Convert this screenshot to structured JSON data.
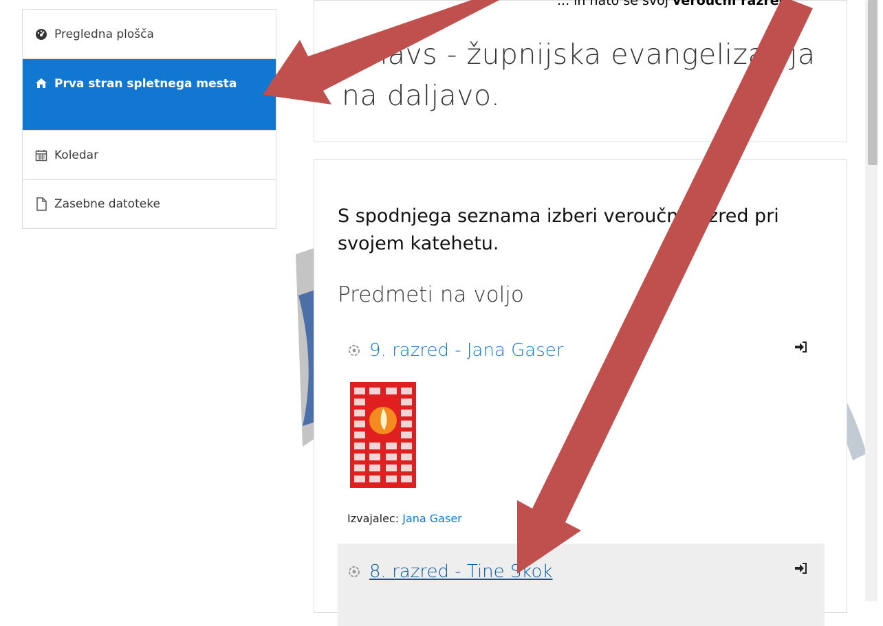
{
  "nav": {
    "items": [
      {
        "label": "Pregledna plošča",
        "icon": "dashboard-icon"
      },
      {
        "label": "Prva stran spletnega mesta",
        "icon": "home-icon",
        "active": true
      },
      {
        "label": "Koledar",
        "icon": "calendar-icon"
      },
      {
        "label": "Zasebne datoteke",
        "icon": "file-icon"
      }
    ]
  },
  "site": {
    "title": "Emavs - župnijska evangelizacija na daljavo."
  },
  "main": {
    "intro": "S spodnjega seznama izberi veroučni razred pri svojem katehetu.",
    "section_heading": "Predmeti na voljo",
    "courses": [
      {
        "name": "9. razred - Jana Gaser",
        "teacher_label": "Izvajalec:",
        "teacher": "Jana Gaser"
      },
      {
        "name": "8. razred - Tine Skok"
      }
    ]
  },
  "annotation": {
    "prefix": "... in nato še svoj",
    "bold": "veroučni razred."
  },
  "colors": {
    "accent": "#1177d1",
    "arrow": "#c0504d"
  }
}
